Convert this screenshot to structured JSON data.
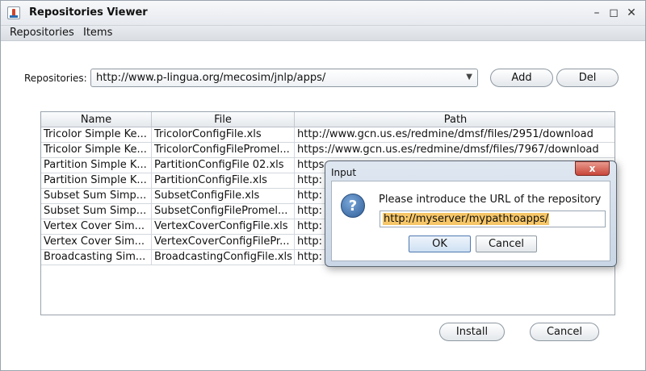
{
  "window": {
    "title": "Repositories Viewer"
  },
  "menu": {
    "items": [
      "Repositories",
      "Items"
    ]
  },
  "repositories": {
    "label": "Repositories:",
    "selected": "http://www.p-lingua.org/mecosim/jnlp/apps/",
    "add_label": "Add",
    "del_label": "Del"
  },
  "table": {
    "columns": [
      "Name",
      "File",
      "Path"
    ],
    "rows": [
      [
        "Tricolor Simple Ke...",
        "TricolorConfigFile.xls",
        "http://www.gcn.us.es/redmine/dmsf/files/2951/download"
      ],
      [
        "Tricolor Simple Ke...",
        "TricolorConfigFilePromel...",
        "https://www.gcn.us.es/redmine/dmsf/files/7967/download"
      ],
      [
        "Partition Simple K...",
        "PartitionConfigFile 02.xls",
        "https"
      ],
      [
        "Partition Simple K...",
        "PartitionConfigFile.xls",
        "http:"
      ],
      [
        "Subset Sum Simp...",
        "SubsetConfigFile.xls",
        "http:"
      ],
      [
        "Subset Sum Simp...",
        "SubsetConfigFilePromel...",
        "http:"
      ],
      [
        "Vertex Cover Sim...",
        "VertexCoverConfigFile.xls",
        "http:"
      ],
      [
        "Vertex Cover Sim...",
        "VertexCoverConfigFilePr...",
        "http:"
      ],
      [
        "Broadcasting Sim...",
        "BroadcastingConfigFile.xls",
        "http:"
      ]
    ]
  },
  "footer": {
    "install_label": "Install",
    "cancel_label": "Cancel"
  },
  "dialog": {
    "title": "Input",
    "close_label": "x",
    "message": "Please introduce the URL of the repository",
    "input_value": "http://myserver/mypathtoapps/",
    "ok_label": "OK",
    "cancel_label": "Cancel"
  }
}
